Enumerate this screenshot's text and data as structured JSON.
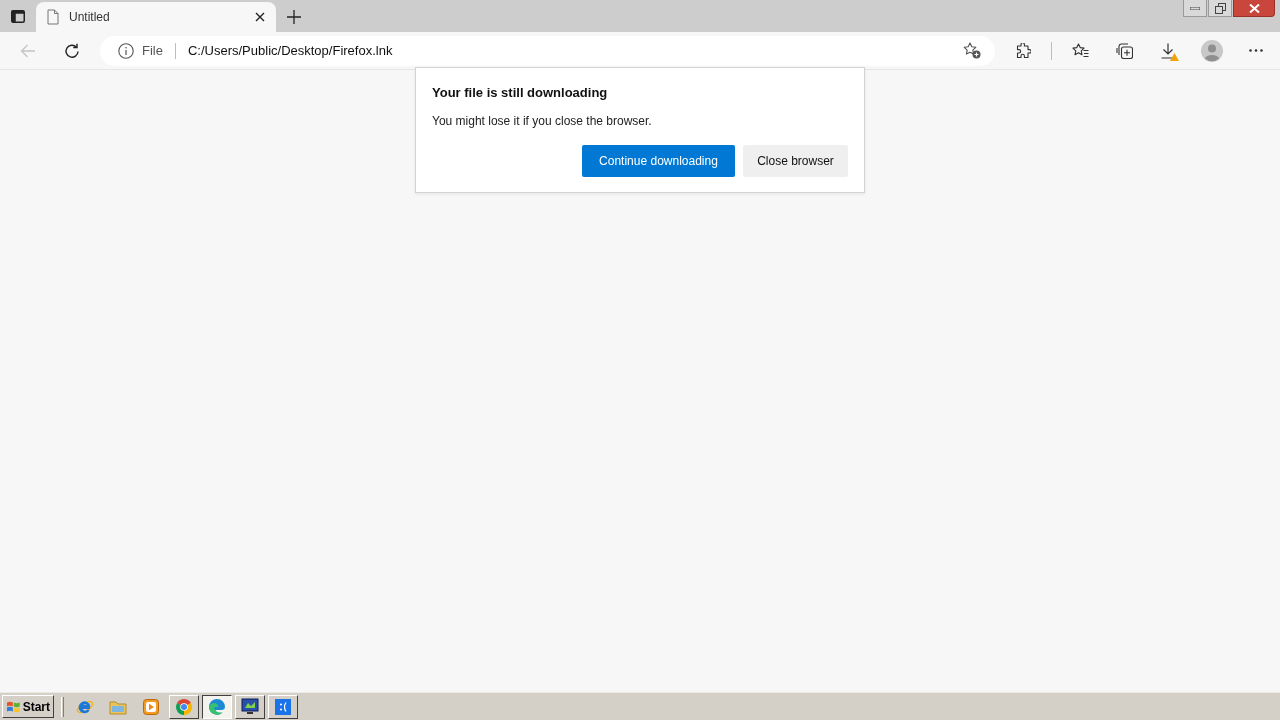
{
  "tabs": [
    {
      "title": "Untitled",
      "selected": true
    }
  ],
  "toolbar": {
    "back_disabled": true,
    "site_label": "File",
    "url": "C:/Users/Public/Desktop/Firefox.lnk",
    "download_warning": true
  },
  "dialog": {
    "title": "Your file is still downloading",
    "message": "You might lose it if you close the browser.",
    "buttons": [
      {
        "label": "Continue downloading",
        "kind": "primary"
      },
      {
        "label": "Close browser",
        "kind": "secondary"
      }
    ]
  },
  "taskbar": {
    "start_label": "Start",
    "programs": [
      {
        "selected": false
      },
      {
        "selected": true
      },
      {
        "selected": false
      },
      {
        "selected": false
      }
    ]
  }
}
